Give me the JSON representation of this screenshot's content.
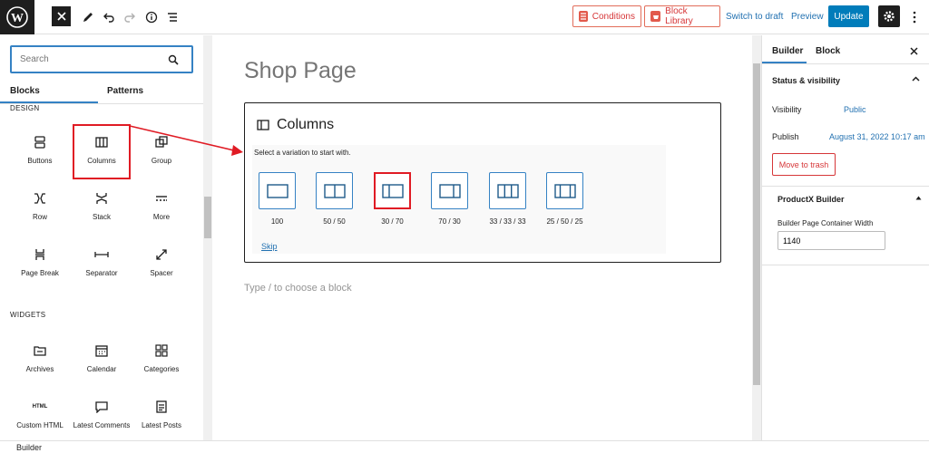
{
  "toolbar": {
    "conditions_label": "Conditions",
    "block_library_label": "Block Library",
    "switch_to_draft_label": "Switch to draft",
    "preview_label": "Preview",
    "update_label": "Update"
  },
  "inserter": {
    "search_placeholder": "Search",
    "tabs": [
      "Blocks",
      "Patterns"
    ],
    "design_section": "DESIGN",
    "design_blocks": [
      "Buttons",
      "Columns",
      "Group",
      "Row",
      "Stack",
      "More",
      "Page Break",
      "Separator",
      "Spacer"
    ],
    "widgets_section": "WIDGETS",
    "widget_blocks": [
      "Archives",
      "Calendar",
      "Categories",
      "Custom HTML",
      "Latest Comments",
      "Latest Posts"
    ],
    "html_icon_text": "HTML"
  },
  "canvas": {
    "page_title": "Shop Page",
    "placeholder_title": "Columns",
    "instructions": "Select a variation to start with.",
    "variations": [
      "100",
      "50 / 50",
      "30 / 70",
      "70 / 30",
      "33 / 33 / 33",
      "25 / 50 / 25"
    ],
    "skip_label": "Skip",
    "type_hint": "Type / to choose a block"
  },
  "sidebar": {
    "tabs": [
      "Builder",
      "Block"
    ],
    "status_title": "Status & visibility",
    "visibility_label": "Visibility",
    "visibility_value": "Public",
    "publish_label": "Publish",
    "publish_value": "August 31, 2022 10:17 am",
    "trash_label": "Move to trash",
    "productx_title": "ProductX Builder",
    "width_label": "Builder Page Container Width",
    "width_value": "1140"
  },
  "footer": {
    "breadcrumb": "Builder"
  },
  "colors": {
    "accent": "#007cba",
    "highlight": "#e01b24",
    "danger": "#d63638"
  }
}
